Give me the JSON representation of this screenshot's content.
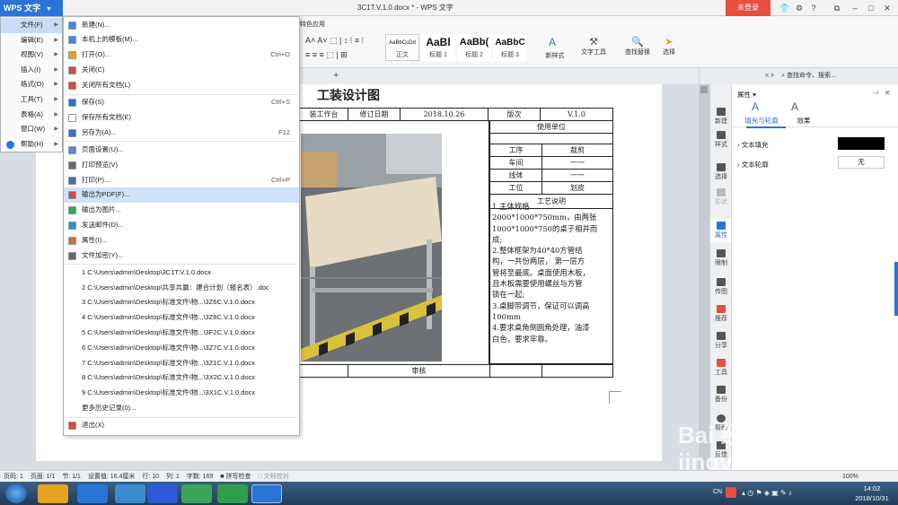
{
  "titlebar": {
    "app_button": "WPS 文字",
    "doc_title": "3C1T.V.1.0.docx * - WPS 文字",
    "login_button": "未登录"
  },
  "ribbon": {
    "tab_partial": "特色应用",
    "styles": [
      {
        "preview": "AaBbCcDd",
        "label": "正文"
      },
      {
        "preview": "AaBl",
        "label": "标题 1"
      },
      {
        "preview": "AaBb(",
        "label": "标题 2"
      },
      {
        "preview": "AaBbC",
        "label": "标题 3"
      }
    ],
    "new_style_label": "新样式",
    "text_tools_label": "文字工具",
    "find_replace_label": "查找替换",
    "select_label": "选择"
  },
  "search": {
    "placeholder": "查找命令、搜索..."
  },
  "file_menu": [
    {
      "label": "文件(F)",
      "has_sub": true,
      "selected": true
    },
    {
      "label": "编辑(E)",
      "has_sub": true
    },
    {
      "label": "视图(V)",
      "has_sub": true
    },
    {
      "label": "插入(I)",
      "has_sub": true
    },
    {
      "label": "格式(O)",
      "has_sub": true
    },
    {
      "label": "工具(T)",
      "has_sub": true
    },
    {
      "label": "表格(A)",
      "has_sub": true
    },
    {
      "label": "窗口(W)",
      "has_sub": true
    },
    {
      "label": "帮助(H)",
      "has_sub": true
    }
  ],
  "submenu": {
    "commands": [
      {
        "label": "新建(N)...",
        "shortcut": "",
        "icon_color": "#4a86d8",
        "icon": "new-doc-icon"
      },
      {
        "label": "本机上的模板(M)...",
        "shortcut": "",
        "icon_color": "#4a86d8",
        "icon": "template-icon"
      },
      {
        "label": "打开(O)...",
        "shortcut": "Ctrl+O",
        "icon_color": "#e8a320",
        "icon": "folder-icon"
      },
      {
        "label": "关闭(C)",
        "shortcut": "",
        "icon_color": "#d84a3a",
        "icon": "close-doc-icon"
      },
      {
        "label": "关闭所有文档(L)",
        "shortcut": "",
        "icon_color": "#d84a3a",
        "icon": "close-all-icon"
      },
      {
        "label": "保存(S)",
        "shortcut": "Ctrl+S",
        "icon_color": "#3a6fc4",
        "icon": "save-icon"
      },
      {
        "label": "保存所有文档(E)",
        "shortcut": "",
        "icon_color": "#ffffff",
        "icon": "save-all-icon"
      },
      {
        "label": "另存为(A)...",
        "shortcut": "F12",
        "icon_color": "#3a6fc4",
        "icon": "save-as-icon"
      },
      {
        "label": "页面设置(U)...",
        "shortcut": "",
        "icon_color": "#5a8ad0",
        "icon": "page-setup-icon"
      },
      {
        "label": "打印预览(V)",
        "shortcut": "",
        "icon_color": "#6a6a6a",
        "icon": "print-preview-icon"
      },
      {
        "label": "打印(P)...",
        "shortcut": "Ctrl+P",
        "icon_color": "#4a6aa8",
        "icon": "print-icon"
      },
      {
        "label": "输出为PDF(F)...",
        "shortcut": "",
        "icon_color": "#d84a3a",
        "icon": "pdf-icon"
      },
      {
        "label": "输出为图片...",
        "shortcut": "",
        "icon_color": "#3aa55a",
        "icon": "image-export-icon"
      },
      {
        "label": "发送邮件(D)...",
        "shortcut": "",
        "icon_color": "#3a8ad0",
        "icon": "mail-icon"
      },
      {
        "label": "属性(I)...",
        "shortcut": "",
        "icon_color": "#d86a3a",
        "icon": "properties-icon"
      },
      {
        "label": "文件加密(Y)...",
        "shortcut": "",
        "icon_color": "#6a6a6a",
        "icon": "encrypt-icon"
      }
    ],
    "recent": [
      "1 C:\\Users\\admin\\Desktop\\3C1T.V.1.0.docx",
      "2 C:\\Users\\admin\\Desktop\\共享共赢：建合计划（报名表）.doc",
      "3 C:\\Users\\admin\\Desktop\\标准文件\\物...\\3Z6C.V.1.0.docx",
      "4 C:\\Users\\admin\\Desktop\\标准文件\\物...\\3Z8C.V.1.0.docx",
      "5 C:\\Users\\admin\\Desktop\\标准文件\\物...\\3F2C.V.1.0.docx",
      "6 C:\\Users\\admin\\Desktop\\标准文件\\物...\\3Z7C.V.1.0.docx",
      "7 C:\\Users\\admin\\Desktop\\标准文件\\物...\\3Z1C.V.1.0.docx",
      "8 C:\\Users\\admin\\Desktop\\标准文件\\物...\\3X2C.V.1.0.docx",
      "9 C:\\Users\\admin\\Desktop\\标准文件\\物...\\3X1C.V.1.0.docx"
    ],
    "more_history": "更多历史记录(0)...",
    "exit": "退出(X)"
  },
  "document": {
    "heading": "工装设计图",
    "row1": [
      "装工作台",
      "修订日期",
      "2018.10.26",
      "版次",
      "V.1.0"
    ],
    "use_unit": "使用单位",
    "unit_rows": [
      [
        "工序",
        "裁剪"
      ],
      [
        "车间",
        "一一"
      ],
      [
        "线体",
        "一一"
      ],
      [
        "工位",
        "划皮"
      ]
    ],
    "process_title": "工艺说明",
    "process_text": "1.主体规格\n2000*1000*750mm，由两张\n1000*1000*750的桌子相并而\n成;\n2.整体框架为40*40方管结\n构，一共份两层， 第一层方\n管将至最底。桌面使用木板，\n且木板需要使用螺丝与方管\n锁在一起;\n3.桌脚带调节，保证可以调高\n100mm\n4.要求桌角倒圆角处理，油漆\n白色，要求牢靠。",
    "review": "审核"
  },
  "side_tabs": [
    "新建",
    "样式",
    "选择",
    "形状",
    "属性",
    "限制",
    "传图",
    "推荐",
    "分享",
    "工具",
    "备份",
    "帮助",
    "反馈"
  ],
  "properties_panel": {
    "title": "属性",
    "tab_fill": "填充与轮廓",
    "tab_effect": "效果",
    "text_fill_label": "文本填充",
    "text_fill_color": "#000000",
    "text_outline_label": "文本轮廓",
    "text_outline_value": "无"
  },
  "statusbar": {
    "page": "页码: 1",
    "pages": "页面: 1/1",
    "section": "节: 1/1",
    "setting": "设置值: 16.4厘米",
    "row": "行: 10",
    "col": "列: 1",
    "words": "字数: 169",
    "spellcheck": "拼写检查",
    "doc_check": "文档校对",
    "zoom": "100%"
  },
  "taskbar": {
    "time": "14:02",
    "date": "2018/10/31",
    "lang": "CN"
  },
  "watermark": "Bai 经验 jingyan.baidu.com"
}
